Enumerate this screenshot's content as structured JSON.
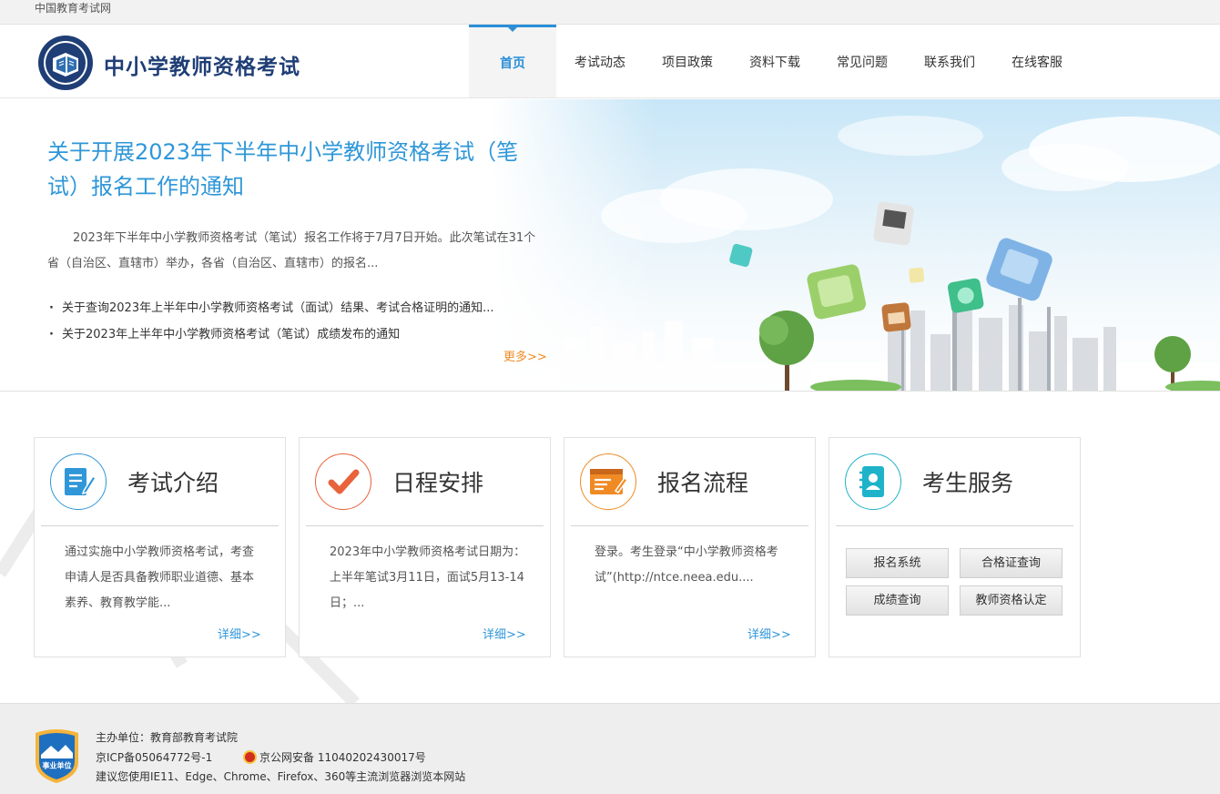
{
  "topbar": {
    "site_name": "中国教育考试网"
  },
  "header": {
    "title": "中小学教师资格考试",
    "nav": [
      {
        "label": "首页",
        "active": true
      },
      {
        "label": "考试动态"
      },
      {
        "label": "项目政策"
      },
      {
        "label": "资料下载"
      },
      {
        "label": "常见问题"
      },
      {
        "label": "联系我们"
      },
      {
        "label": "在线客服"
      }
    ]
  },
  "hero": {
    "title": "关于开展2023年下半年中小学教师资格考试（笔试）报名工作的通知",
    "summary": "2023年下半年中小学教师资格考试（笔试）报名工作将于7月7日开始。此次笔试在31个省（自治区、直辖市）举办，各省（自治区、直辖市）的报名...",
    "news": [
      "关于查询2023年上半年中小学教师资格考试（面试）结果、考试合格证明的通知...",
      "关于2023年上半年中小学教师资格考试（笔试）成绩发布的通知"
    ],
    "more": "更多>>"
  },
  "cards": {
    "intro": {
      "title": "考试介绍",
      "body": "通过实施中小学教师资格考试，考查申请人是否具备教师职业道德、基本素养、教育教学能...",
      "more": "详细>>",
      "icon": "document-pen-icon"
    },
    "schedule": {
      "title": "日程安排",
      "body": "2023年中小学教师资格考试日期为：上半年笔试3月11日，面试5月13-14日；...",
      "more": "详细>>",
      "icon": "checkmark-icon"
    },
    "process": {
      "title": "报名流程",
      "body": "登录。考生登录“中小学教师资格考试”(http://ntce.neea.edu....",
      "more": "详细>>",
      "icon": "form-edit-icon"
    },
    "services": {
      "title": "考生服务",
      "icon": "address-book-icon",
      "buttons": [
        "报名系统",
        "合格证查询",
        "成绩查询",
        "教师资格认定"
      ]
    }
  },
  "footer": {
    "sponsor": "主办单位：教育部教育考试院",
    "icp": "京ICP备05064772号-1",
    "police": "京公网安备 11040202430017号",
    "browser_tip": "建议您使用IE11、Edge、Chrome、Firefox、360等主流浏览器浏览本网站",
    "badge_text": "事业单位"
  },
  "colors": {
    "brand_blue": "#2f97d8",
    "nav_active": "#2b8fd6",
    "more_orange": "#f08a24",
    "title_navy": "#1f3e76"
  }
}
